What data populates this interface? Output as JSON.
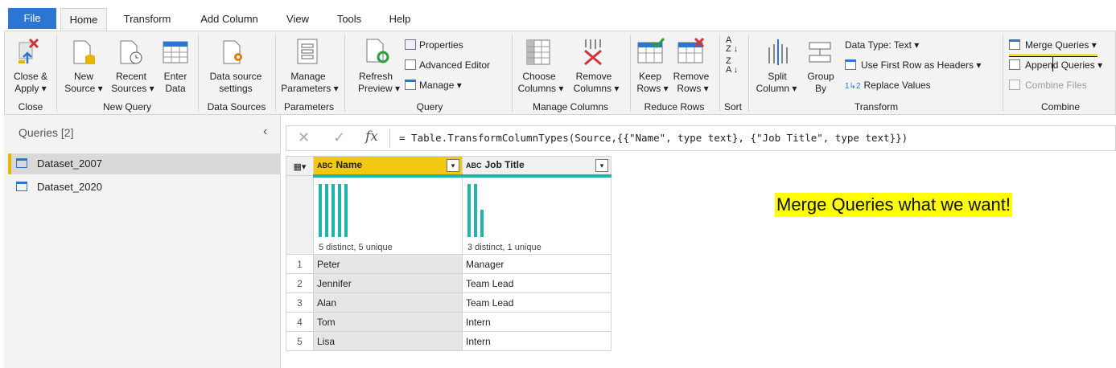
{
  "tabs": [
    "File",
    "Home",
    "Transform",
    "Add Column",
    "View",
    "Tools",
    "Help"
  ],
  "groups": {
    "close": {
      "btn1": "Close &",
      "btn2": "Apply",
      "label": "Close"
    },
    "new_query": {
      "new1": "New",
      "new2": "Source",
      "recent1": "Recent",
      "recent2": "Sources",
      "enter1": "Enter",
      "enter2": "Data",
      "label": "New Query"
    },
    "data_sources": {
      "btn1": "Data source",
      "btn2": "settings",
      "label": "Data Sources"
    },
    "parameters": {
      "btn1": "Manage",
      "btn2": "Parameters",
      "label": "Parameters"
    },
    "query": {
      "refresh1": "Refresh",
      "refresh2": "Preview",
      "properties": "Properties",
      "advanced": "Advanced Editor",
      "manage": "Manage",
      "label": "Query"
    },
    "manage_columns": {
      "choose1": "Choose",
      "choose2": "Columns",
      "remove1": "Remove",
      "remove2": "Columns",
      "label": "Manage Columns"
    },
    "reduce_rows": {
      "keep1": "Keep",
      "keep2": "Rows",
      "remove1": "Remove",
      "remove2": "Rows",
      "label": "Reduce Rows"
    },
    "sort": {
      "label": "Sort"
    },
    "transform": {
      "split1": "Split",
      "split2": "Column",
      "group1": "Group",
      "group2": "By",
      "datatype": "Data Type: Text",
      "firstrow": "Use First Row as Headers",
      "replace": "Replace Values",
      "label": "Transform"
    },
    "combine": {
      "merge": "Merge Queries",
      "append": "Append Queries",
      "combine": "Combine Files",
      "label": "Combine"
    }
  },
  "queries": {
    "title": "Queries [2]",
    "items": [
      "Dataset_2007",
      "Dataset_2020"
    ]
  },
  "formula": "= Table.TransformColumnTypes(Source,{{\"Name\", type text}, {\"Job Title\", type text}})",
  "grid": {
    "columns": [
      {
        "name": "Name",
        "stats": "5 distinct, 5 unique"
      },
      {
        "name": "Job Title",
        "stats": "3 distinct, 1 unique"
      }
    ],
    "rows": [
      [
        "1",
        "Peter",
        "Manager"
      ],
      [
        "2",
        "Jennifer",
        "Team Lead"
      ],
      [
        "3",
        "Alan",
        "Team Lead"
      ],
      [
        "4",
        "Tom",
        "Intern"
      ],
      [
        "5",
        "Lisa",
        "Intern"
      ]
    ],
    "type_icon": "ABC"
  },
  "annotation": "Merge Queries what we want!",
  "colors": {
    "accent": "#2b76d2",
    "selected_col": "#f2c811",
    "bars": "#1fb5a8",
    "note": "#ffff00"
  }
}
